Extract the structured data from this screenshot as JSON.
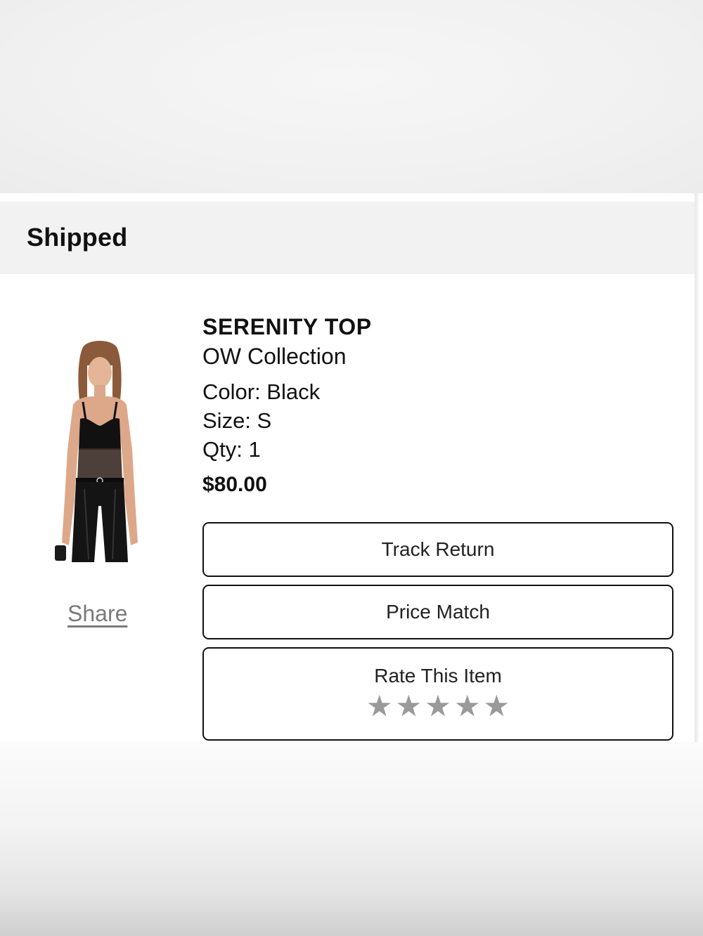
{
  "order": {
    "status": "Shipped"
  },
  "item": {
    "name": "SERENITY TOP",
    "brand": "OW Collection",
    "color": "Color: Black",
    "size": "Size: S",
    "qty": "Qty: 1",
    "price": "$80.00",
    "share_label": "Share",
    "image_icon": "product-photo"
  },
  "actions": {
    "track_return": "Track Return",
    "price_match": "Price Match",
    "rate_item": "Rate This Item",
    "rating": 0,
    "max_rating": 5,
    "star_glyph": "★"
  },
  "colors": {
    "star_inactive": "#9a9a9a",
    "status_bar_bg": "#f2f2f2",
    "link": "#7a7a7a"
  }
}
